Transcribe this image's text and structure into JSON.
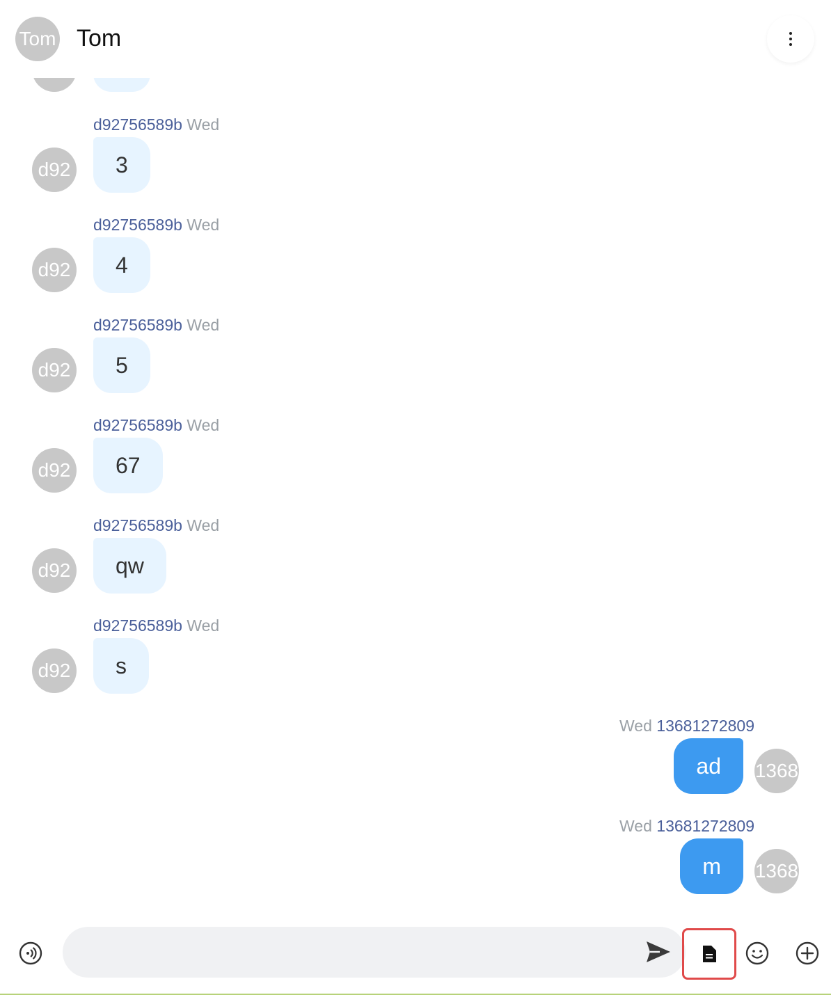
{
  "header": {
    "avatar_text": "Tom",
    "title": "Tom"
  },
  "messages": [
    {
      "direction": "in",
      "avatar": "d92",
      "sender": "d92756589b",
      "time": "Wed",
      "text": "3"
    },
    {
      "direction": "in",
      "avatar": "d92",
      "sender": "d92756589b",
      "time": "Wed",
      "text": "4"
    },
    {
      "direction": "in",
      "avatar": "d92",
      "sender": "d92756589b",
      "time": "Wed",
      "text": "5"
    },
    {
      "direction": "in",
      "avatar": "d92",
      "sender": "d92756589b",
      "time": "Wed",
      "text": "67"
    },
    {
      "direction": "in",
      "avatar": "d92",
      "sender": "d92756589b",
      "time": "Wed",
      "text": "qw"
    },
    {
      "direction": "in",
      "avatar": "d92",
      "sender": "d92756589b",
      "time": "Wed",
      "text": "s"
    },
    {
      "direction": "out",
      "avatar": "1368",
      "sender": "13681272809",
      "time": "Wed",
      "text": "ad"
    },
    {
      "direction": "out",
      "avatar": "1368",
      "sender": "13681272809",
      "time": "Wed",
      "text": "m"
    }
  ],
  "input": {
    "value": "",
    "placeholder": ""
  },
  "icons": {
    "more": "more-vertical-icon",
    "voice": "voice-icon",
    "send": "send-icon",
    "document": "document-icon",
    "emoji": "emoji-icon",
    "plus": "plus-circle-icon"
  },
  "colors": {
    "incoming_bubble": "#e7f4ff",
    "outgoing_bubble": "#3d9af0",
    "sender_name": "#4a5f9a",
    "highlight": "#e04a4a"
  }
}
